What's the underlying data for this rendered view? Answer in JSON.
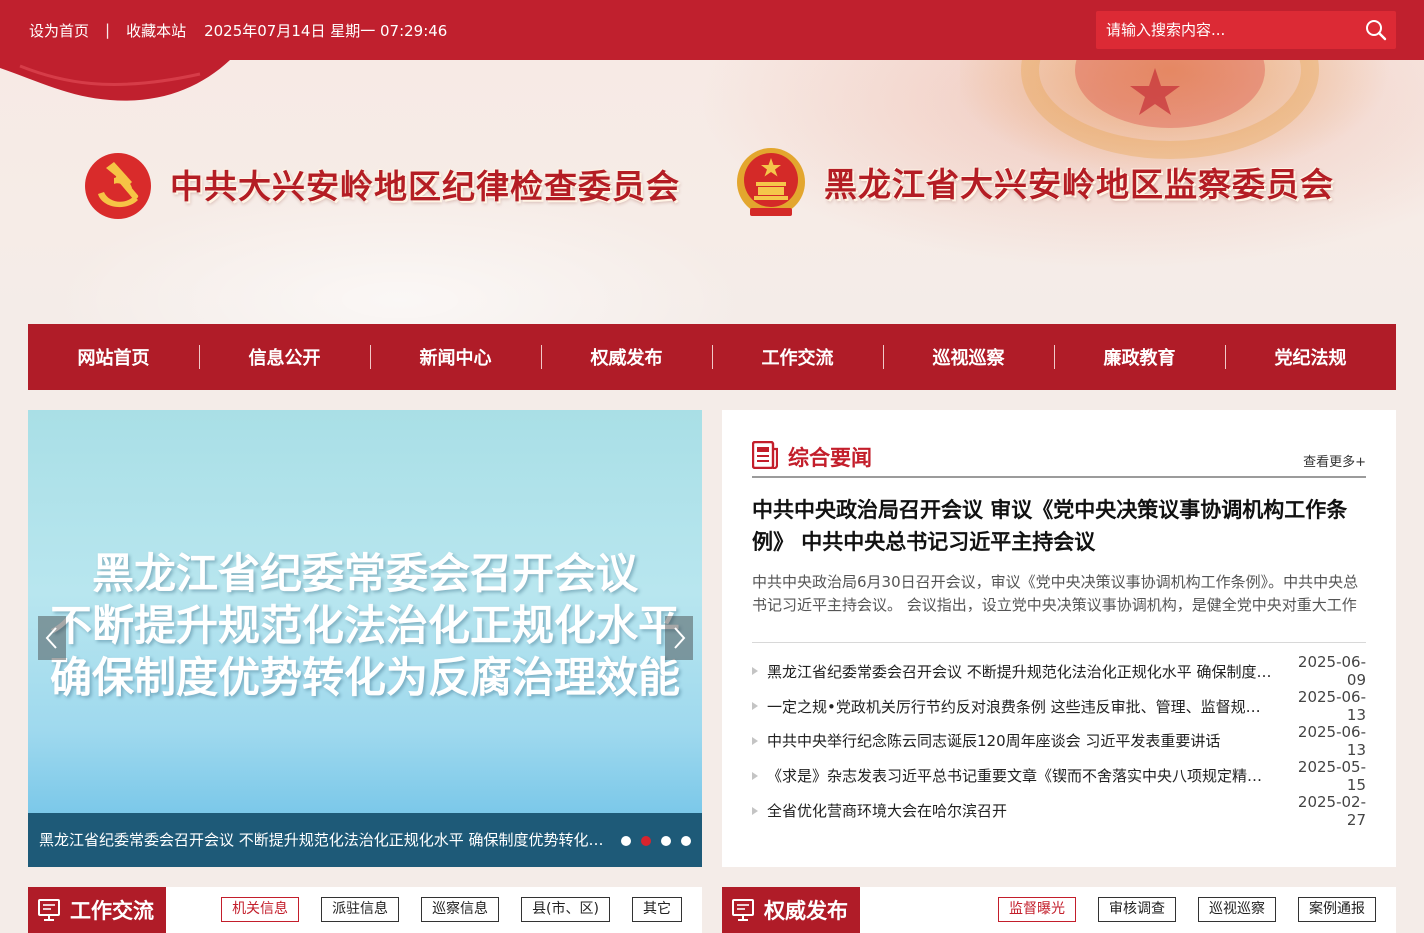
{
  "topbar": {
    "set_home": "设为首页",
    "separator": "|",
    "bookmark": "收藏本站",
    "datetime": "2025年07月14日 星期一 07:29:46",
    "search_placeholder": "请输入搜索内容..."
  },
  "banner": {
    "org1": "中共大兴安岭地区纪律检查委员会",
    "org2": "黑龙江省大兴安岭地区监察委员会"
  },
  "nav": {
    "items": [
      {
        "label": "网站首页"
      },
      {
        "label": "信息公开"
      },
      {
        "label": "新闻中心"
      },
      {
        "label": "权威发布"
      },
      {
        "label": "工作交流"
      },
      {
        "label": "巡视巡察"
      },
      {
        "label": "廉政教育"
      },
      {
        "label": "党纪法规"
      }
    ]
  },
  "slider": {
    "lines": [
      "黑龙江省纪委常委会召开会议",
      "不断提升规范化法治化正规化水平",
      "确保制度优势转化为反腐治理效能"
    ],
    "caption": "黑龙江省纪委常委会召开会议 不断提升规范化法治化正规化水平 确保制度优势转化为反腐治理效能",
    "dot_count": 4,
    "active_dot": 2
  },
  "news": {
    "title": "综合要闻",
    "more": "查看更多+",
    "headline": "中共中央政治局召开会议 审议《党中央决策议事协调机构工作条例》 中共中央总书记习近平主持会议",
    "summary": "中共中央政治局6月30日召开会议，审议《党中央决策议事协调机构工作条例》。中共中央总书记习近平主持会议。 会议指出，设立党中央决策议事协调机构，是健全党中央对重大工作的领导体制的重要举措。",
    "items": [
      {
        "title": "黑龙江省纪委常委会召开会议 不断提升规范化法治化正规化水平 确保制度优势转化为反腐治理效能",
        "date": "2025-06-09"
      },
      {
        "title": "一定之规•党政机关厉行节约反对浪费条例 这些违反审批、管理、监督规定的行为要受处分",
        "date": "2025-06-13"
      },
      {
        "title": "中共中央举行纪念陈云同志诞辰120周年座谈会 习近平发表重要讲话",
        "date": "2025-06-13"
      },
      {
        "title": "《求是》杂志发表习近平总书记重要文章《锲而不舍落实中央八项规定精神》",
        "date": "2025-05-15"
      },
      {
        "title": "全省优化营商环境大会在哈尔滨召开",
        "date": "2025-02-27"
      }
    ]
  },
  "sections": [
    {
      "title": "工作交流",
      "tabs": [
        "机关信息",
        "派驻信息",
        "巡察信息",
        "县(市、区)",
        "其它"
      ],
      "active": 0
    },
    {
      "title": "权威发布",
      "tabs": [
        "监督曝光",
        "审核调查",
        "巡视巡察",
        "案例通报"
      ],
      "active": 0
    }
  ],
  "colors": {
    "primary": "#c0202e",
    "nav": "#b01c28",
    "accent_text": "#c31e2b"
  }
}
